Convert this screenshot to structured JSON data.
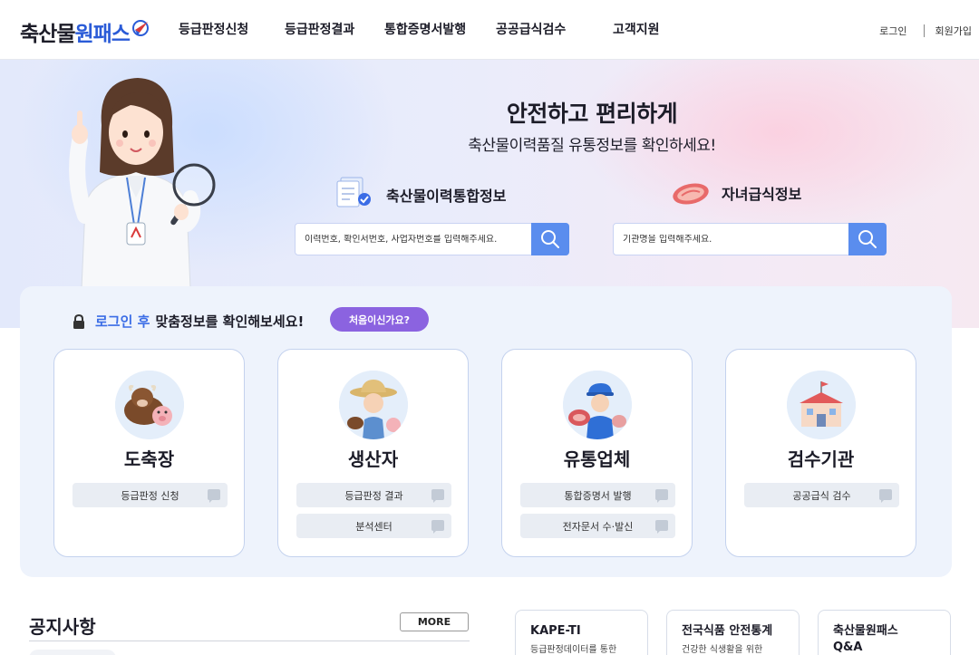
{
  "header": {
    "logo_prefix": "축산물",
    "logo_suffix": "원패스",
    "nav": [
      "등급판정신청",
      "등급판정결과",
      "통합증명서발행",
      "공공급식검수",
      "고객지원"
    ],
    "login": "로그인",
    "signup": "회원가입"
  },
  "hero": {
    "title": "안전하고 편리하게",
    "subtitle": "축산물이력품질 유통정보를 확인하세요!",
    "search_left": {
      "title": "축산물이력통합정보",
      "placeholder": "이력번호, 확인서번호, 사업자번호를 입력해주세요."
    },
    "search_right": {
      "title": "자녀급식정보",
      "placeholder": "기관명을 입력해주세요."
    }
  },
  "panel": {
    "login_highlight": "로그인 후",
    "login_text": "맞춤정보를 확인해보세요!",
    "first_button": "처음이신가요?",
    "cards": [
      {
        "title": "도축장",
        "buttons": [
          "등급판정 신청"
        ]
      },
      {
        "title": "생산자",
        "buttons": [
          "등급판정 결과",
          "분석센터"
        ]
      },
      {
        "title": "유통업체",
        "buttons": [
          "통합증명서 발행",
          "전자문서 수·발신"
        ]
      },
      {
        "title": "검수기관",
        "buttons": [
          "공공급식 검수"
        ]
      }
    ]
  },
  "notice": {
    "title": "공지사항",
    "more": "MORE"
  },
  "bottom_cards": [
    {
      "title": "KAPE-TI",
      "desc": "등급판정데이터를 통한"
    },
    {
      "title": "전국식품 안전통계",
      "desc": "건강한 식생활을 위한"
    },
    {
      "title": "축산물원패스\nQ&A",
      "title_line1": "축산물원패스",
      "title_line2": "Q&A"
    }
  ],
  "colors": {
    "brand_blue": "#2a5bd7",
    "search_button": "#5a8dee",
    "first_button": "#8b63e0",
    "panel_bg": "#eef3fc"
  }
}
